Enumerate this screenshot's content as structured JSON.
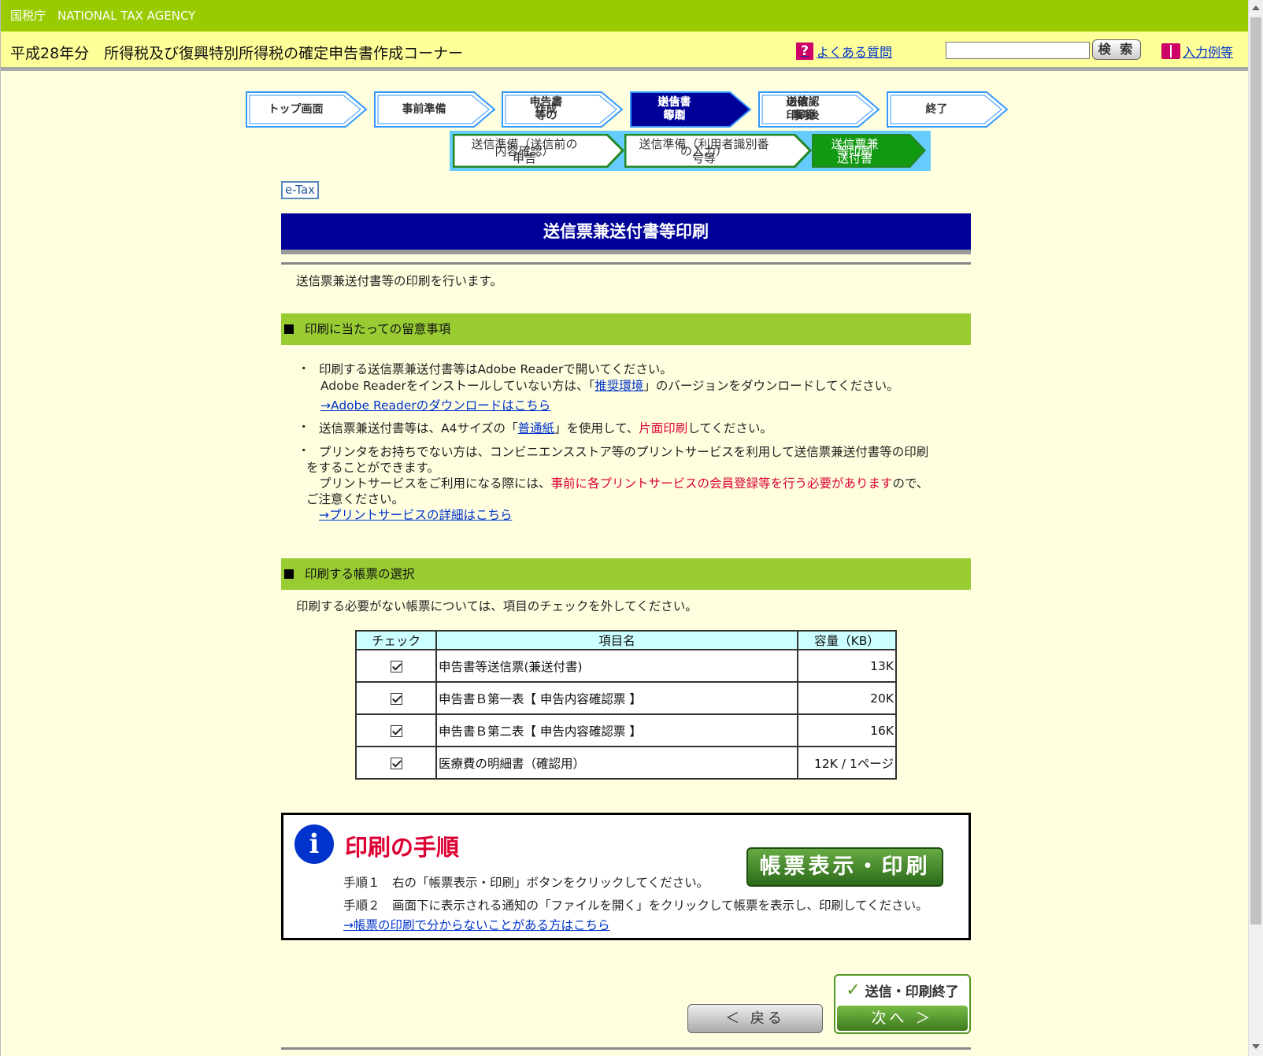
{
  "agency": "国税庁　NATIONAL TAX AGENCY",
  "header": {
    "title": "平成28年分　所得税及び復興特別所得税の確定申告書作成コーナー",
    "faq_icon": "?",
    "faq": "よくある質問",
    "search_button": "検 索",
    "examples": "入力例等"
  },
  "steps": [
    {
      "line1": "トップ画面",
      "line2": ""
    },
    {
      "line1": "事前準備",
      "line2": ""
    },
    {
      "line1": "申告書等の",
      "line2": "作成"
    },
    {
      "line1": "申告書等の",
      "line2": "送信・印刷"
    },
    {
      "line1": "送信・印刷後",
      "line2": "の確認事項"
    },
    {
      "line1": "終了",
      "line2": ""
    }
  ],
  "substeps": [
    {
      "line1": "送信準備（送信前の申告",
      "line2": "内容確認）"
    },
    {
      "line1": "送信準備（利用者識別番号等",
      "line2": "の入力）"
    },
    {
      "line1": "送信票兼送付書",
      "line2": "等印刷"
    }
  ],
  "etax": "e-Tax",
  "page_title": "送信票兼送付書等印刷",
  "intro": "送信票兼送付書等の印刷を行います。",
  "notes": {
    "heading": "印刷に当たっての留意事項",
    "bullet": "・",
    "n1_line1": "印刷する送信票兼送付書等はAdobe Readerで開いてください。",
    "n1_line2_pre": "Adobe Readerをインストールしていない方は、「",
    "n1_line2_link": "推奨環境",
    "n1_line2_post": "」のバージョンをダウンロードしてください。",
    "n1_link": "→Adobe Readerのダウンロードはこちら",
    "n2_pre": "送信票兼送付書等は、A4サイズの「",
    "n2_link": "普通紙",
    "n2_mid": "」を使用して、",
    "n2_red": "片面印刷",
    "n2_post": "してください。",
    "n3_line1": "プリンタをお持ちでない方は、コンビニエンスストア等のプリントサービスを利用して送信票兼送付書等の印刷",
    "n3_line2": "をすることができます。",
    "n3_line3_pre": "プリントサービスをご利用になる際には、",
    "n3_line3_red": "事前に各プリントサービスの会員登録等を行う必要があります",
    "n3_line3_post": "ので、",
    "n3_line4": "ご注意ください。",
    "n3_link": "→プリントサービスの詳細はこちら"
  },
  "selection": {
    "heading": "印刷する帳票の選択",
    "instruction": "印刷する必要がない帳票については、項目のチェックを外してください。",
    "columns": [
      "チェック",
      "項目名",
      "容量（KB）"
    ],
    "rows": [
      {
        "name": "申告書等送信票(兼送付書)",
        "size": "13K",
        "checked": true
      },
      {
        "name": "申告書Ｂ第一表【 申告内容確認票 】",
        "size": "20K",
        "checked": true
      },
      {
        "name": "申告書Ｂ第二表【 申告内容確認票 】",
        "size": "16K",
        "checked": true
      },
      {
        "name": "医療費の明細書（確認用）",
        "size": "12K / 1ページ",
        "checked": true
      }
    ]
  },
  "procedure": {
    "title": "印刷の手順",
    "step1": "手順１　右の「帳票表示・印刷」ボタンをクリックしてください。",
    "step2": "手順２　画面下に表示される通知の「ファイルを開く」をクリックして帳票を表示し、印刷してください。",
    "link": "→帳票の印刷で分からないことがある方はこちら",
    "print_button": "帳票表示・印刷"
  },
  "nav": {
    "back": "＜ 戻る",
    "finish": "送信・印刷終了",
    "next": "次へ ＞"
  },
  "colors": {
    "green_bar": "#99cc00",
    "title_blue": "#000099",
    "section_green": "#99cc33",
    "step_active": "#000099"
  }
}
